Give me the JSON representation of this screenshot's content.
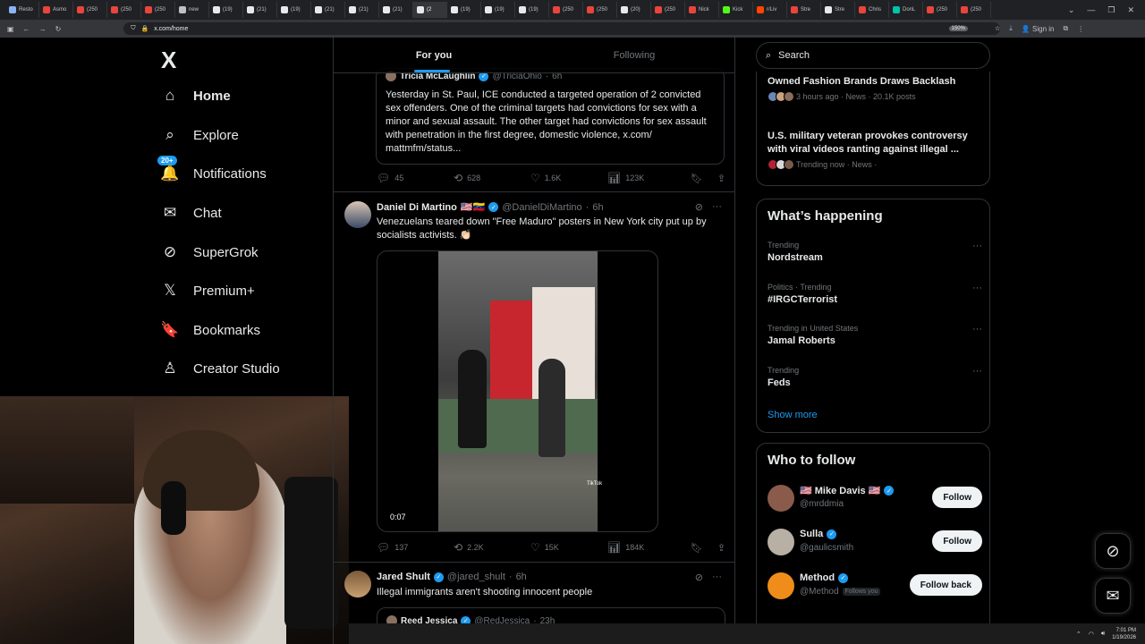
{
  "browser": {
    "tabs": [
      {
        "label": "Resto",
        "color": "#8ab4f8"
      },
      {
        "label": "Asmo",
        "color": "#e8453c"
      },
      {
        "label": "(250",
        "color": "#e8453c"
      },
      {
        "label": "(250",
        "color": "#e8453c"
      },
      {
        "label": "(250",
        "color": "#e8453c"
      },
      {
        "label": "new",
        "color": "#bdc1c6"
      },
      {
        "label": "(19)",
        "color": "#e7e9ea"
      },
      {
        "label": "(21)",
        "color": "#e7e9ea"
      },
      {
        "label": "(19)",
        "color": "#e7e9ea"
      },
      {
        "label": "(21)",
        "color": "#e7e9ea"
      },
      {
        "label": "(21)",
        "color": "#e7e9ea"
      },
      {
        "label": "(21)",
        "color": "#e7e9ea"
      },
      {
        "label": "(2",
        "color": "#e7e9ea"
      },
      {
        "label": "(19)",
        "color": "#e7e9ea"
      },
      {
        "label": "(19)",
        "color": "#e7e9ea"
      },
      {
        "label": "(19)",
        "color": "#e7e9ea"
      },
      {
        "label": "(250",
        "color": "#e8453c"
      },
      {
        "label": "(250",
        "color": "#e8453c"
      },
      {
        "label": "(20)",
        "color": "#e7e9ea"
      },
      {
        "label": "(250",
        "color": "#e8453c"
      },
      {
        "label": "Nick",
        "color": "#e8453c"
      },
      {
        "label": "Kick",
        "color": "#53fc18"
      },
      {
        "label": "r/Liv",
        "color": "#ff4500"
      },
      {
        "label": "Stre",
        "color": "#e8453c"
      },
      {
        "label": "Stre",
        "color": "#e7e9ea"
      },
      {
        "label": "Chris",
        "color": "#e8453c"
      },
      {
        "label": "DonL",
        "color": "#00c2a8"
      },
      {
        "label": "(250",
        "color": "#e8453c"
      },
      {
        "label": "(250",
        "color": "#e8453c"
      }
    ],
    "active_tab_index": 12,
    "url": "x.com/home",
    "zoom": "150%",
    "sign_in": "Sign in"
  },
  "nav": {
    "logo": "X",
    "items": [
      {
        "label": "Home",
        "icon": "home-icon",
        "glyph": "⌂",
        "bold": true
      },
      {
        "label": "Explore",
        "icon": "search-icon",
        "glyph": "⌕"
      },
      {
        "label": "Notifications",
        "icon": "bell-icon",
        "glyph": "🔔",
        "badge": "20+"
      },
      {
        "label": "Chat",
        "icon": "mail-icon",
        "glyph": "✉"
      },
      {
        "label": "SuperGrok",
        "icon": "grok-icon",
        "glyph": "⊘"
      },
      {
        "label": "Premium+",
        "icon": "x-premium-icon",
        "glyph": "𝕏"
      },
      {
        "label": "Bookmarks",
        "icon": "bookmark-icon",
        "glyph": "🔖"
      },
      {
        "label": "Creator Studio",
        "icon": "creator-studio-icon",
        "glyph": "♙"
      }
    ]
  },
  "feed": {
    "tabs": [
      "For you",
      "Following"
    ],
    "quote1": {
      "name": "Tricia McLaughlin",
      "handle": "@TriciaOhio",
      "time": "6h",
      "text": "Yesterday in St. Paul, ICE conducted a targeted operation of 2 convicted sex offenders. One of the criminal targets had convictions for sex with a minor and sexual assault. The other target had convictions for sex assault with penetration in the first degree, domestic violence, x.com/ mattmfm/status..."
    },
    "actions1": {
      "replies": "45",
      "reposts": "628",
      "likes": "1.6K",
      "views": "123K"
    },
    "post2": {
      "name": "Daniel Di Martino",
      "flags": "🇺🇸🇻🇪",
      "handle": "@DanielDiMartino",
      "time": "6h",
      "text": "Venezuelans teared down \"Free Maduro\" posters in New York city put up by socialists activists. 👏🏻",
      "video_duration": "0:07",
      "watermark": "TikTok"
    },
    "actions2": {
      "replies": "137",
      "reposts": "2.2K",
      "likes": "15K",
      "views": "184K"
    },
    "post3": {
      "name": "Jared Shult",
      "handle": "@jared_shult",
      "time": "6h",
      "text": "Illegal immigrants aren't shooting innocent people"
    },
    "quote3": {
      "name": "Reed Jessica",
      "handle": "@RedJessica",
      "time": "23h"
    }
  },
  "right": {
    "search_placeholder": "Search",
    "news": [
      {
        "title": "Owned Fashion Brands Draws Backlash",
        "meta": "3 hours ago · News · 20.1K posts"
      },
      {
        "title": "U.S. military veteran provokes controversy with viral videos ranting against illegal ...",
        "meta": "Trending now · News ·"
      }
    ],
    "whats_happening": {
      "title": "What’s happening",
      "trends": [
        {
          "context": "Trending",
          "name": "Nordstream"
        },
        {
          "context": "Politics · Trending",
          "name": "#IRGCTerrorist"
        },
        {
          "context": "Trending in United States",
          "name": "Jamal Roberts"
        },
        {
          "context": "Trending",
          "name": "Feds"
        }
      ],
      "show_more": "Show more"
    },
    "who_to_follow": {
      "title": "Who to follow",
      "accounts": [
        {
          "name": "🇺🇸 Mike Davis 🇺🇸",
          "handle": "@mrddmia",
          "button": "Follow",
          "avatar_color": "#8a5a4a",
          "follows_you": ""
        },
        {
          "name": "Sulla",
          "handle": "@gaulicsmith",
          "button": "Follow",
          "avatar_color": "#b8b0a4",
          "follows_you": ""
        },
        {
          "name": "Method",
          "handle": "@Method",
          "button": "Follow back",
          "avatar_color": "#f08c1a",
          "follows_you": "Follows you"
        }
      ]
    }
  },
  "taskbar": {
    "time": "7:01 PM",
    "date": "1/19/2026"
  },
  "colors": {
    "accent": "#1d9bf0",
    "bg": "#000000",
    "border": "#2f3336",
    "muted": "#71767b"
  }
}
